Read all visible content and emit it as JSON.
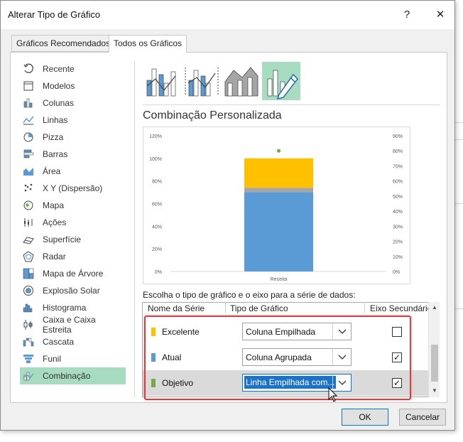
{
  "window": {
    "title": "Alterar Tipo de Gráfico",
    "help": "?",
    "close": "✕"
  },
  "tabs": [
    {
      "label": "Gráficos Recomendados"
    },
    {
      "label": "Todos os Gráficos"
    }
  ],
  "categories": [
    {
      "label": "Recente",
      "icon": "recent-icon"
    },
    {
      "label": "Modelos",
      "icon": "templates-icon"
    },
    {
      "label": "Colunas",
      "icon": "column-chart-icon"
    },
    {
      "label": "Linhas",
      "icon": "line-chart-icon"
    },
    {
      "label": "Pizza",
      "icon": "pie-chart-icon"
    },
    {
      "label": "Barras",
      "icon": "bar-chart-icon"
    },
    {
      "label": "Área",
      "icon": "area-chart-icon"
    },
    {
      "label": "X Y (Dispersão)",
      "icon": "scatter-chart-icon"
    },
    {
      "label": "Mapa",
      "icon": "map-chart-icon"
    },
    {
      "label": "Ações",
      "icon": "stock-chart-icon"
    },
    {
      "label": "Superfície",
      "icon": "surface-chart-icon"
    },
    {
      "label": "Radar",
      "icon": "radar-chart-icon"
    },
    {
      "label": "Mapa de Árvore",
      "icon": "treemap-chart-icon"
    },
    {
      "label": "Explosão Solar",
      "icon": "sunburst-chart-icon"
    },
    {
      "label": "Histograma",
      "icon": "histogram-chart-icon"
    },
    {
      "label": "Caixa e Caixa Estreita",
      "icon": "box-whisker-chart-icon"
    },
    {
      "label": "Cascata",
      "icon": "waterfall-chart-icon"
    },
    {
      "label": "Funil",
      "icon": "funnel-chart-icon"
    },
    {
      "label": "Combinação",
      "icon": "combo-chart-icon",
      "selected": true
    }
  ],
  "subtypes": [
    "clustered-column-line-icon",
    "clustered-column-line-secondary-icon",
    "stacked-area-clustered-column-icon",
    "custom-combination-icon"
  ],
  "heading": "Combinação Personalizada",
  "chart_data": {
    "type": "bar",
    "categories": [
      "Receita"
    ],
    "series": [
      {
        "name": "Atual",
        "values": [
          70
        ],
        "color": "#5b9bd5",
        "kind": "stacked-column"
      },
      {
        "name": "Objetivo",
        "values": [
          4
        ],
        "color": "#a5a5a5",
        "kind": "stacked-column"
      },
      {
        "name": "Excelente",
        "values": [
          26
        ],
        "color": "#ffc000",
        "kind": "stacked-column"
      },
      {
        "name": "Objetivo-point",
        "values": [
          80
        ],
        "color": "#70ad47",
        "kind": "line-marker",
        "axis": "secondary"
      }
    ],
    "y_ticks": [
      "0%",
      "20%",
      "40%",
      "60%",
      "80%",
      "100%",
      "120%"
    ],
    "y2_ticks": [
      "0%",
      "10%",
      "20%",
      "30%",
      "40%",
      "50%",
      "60%",
      "70%",
      "80%",
      "90%"
    ],
    "ylim": [
      0,
      120
    ],
    "y2lim": [
      0,
      90
    ],
    "grid": false
  },
  "instruction": "Escolha o tipo de gráfico e o eixo para a série de dados:",
  "grid_headers": {
    "name": "Nome da Série",
    "type": "Tipo de Gráfico",
    "axis": "Eixo Secundário"
  },
  "series_rows": [
    {
      "name": "Excelente",
      "color": "#ffc000",
      "type": "Coluna Empilhada",
      "secondary": ""
    },
    {
      "name": "Atual",
      "color": "#5b9bd5",
      "type": "Coluna Agrupada",
      "secondary": "✓"
    },
    {
      "name": "Objetivo",
      "color": "#70ad47",
      "type": "Linha Empilhada com...",
      "secondary": "✓"
    }
  ],
  "buttons": {
    "ok": "OK",
    "cancel": "Cancelar"
  }
}
